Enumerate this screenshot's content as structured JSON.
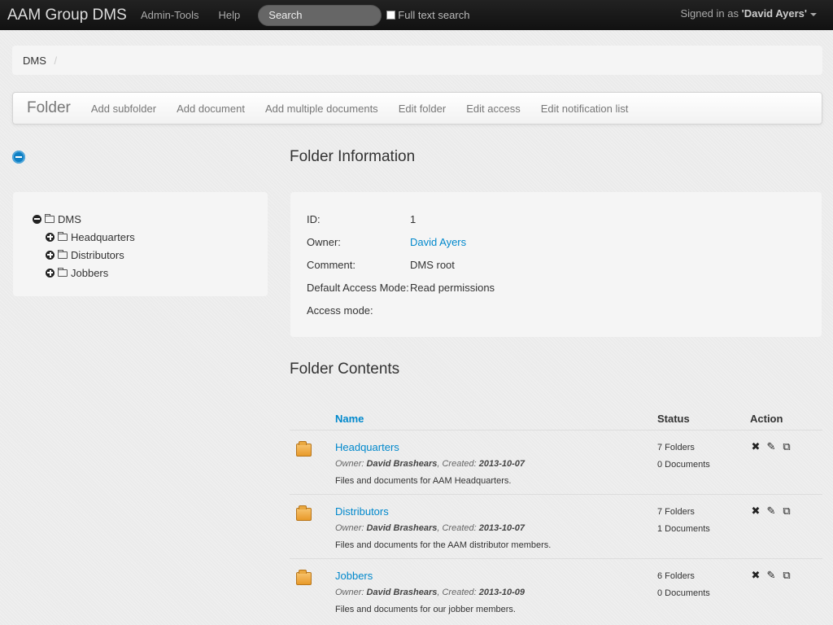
{
  "navbar": {
    "brand": "AAM Group DMS",
    "items": [
      "Admin-Tools",
      "Help"
    ],
    "search_placeholder": "Search",
    "full_text_label": "Full text search",
    "signed_in_prefix": "Signed in as",
    "user": "'David Ayers'"
  },
  "breadcrumb": {
    "root": "DMS",
    "separator": "/"
  },
  "subnav": {
    "title": "Folder",
    "items": [
      "Add subfolder",
      "Add document",
      "Add multiple documents",
      "Edit folder",
      "Edit access",
      "Edit notification list"
    ]
  },
  "tree": {
    "root": "DMS",
    "children": [
      "Headquarters",
      "Distributors",
      "Jobbers"
    ]
  },
  "info": {
    "heading": "Folder Information",
    "rows": [
      {
        "label": "ID:",
        "value": "1"
      },
      {
        "label": "Owner:",
        "value": "David Ayers"
      },
      {
        "label": "Comment:",
        "value": "DMS root"
      },
      {
        "label": "Default Access Mode:",
        "value": "Read permissions"
      },
      {
        "label": "Access mode:",
        "value": ""
      }
    ]
  },
  "contents": {
    "heading": "Folder Contents",
    "columns": {
      "name": "Name",
      "status": "Status",
      "action": "Action"
    },
    "rows": [
      {
        "name": "Headquarters",
        "owner_prefix": "Owner:",
        "owner": "David Brashears",
        "created_prefix": ", Created:",
        "created": "2013-10-07",
        "description": "Files and documents for AAM Headquarters.",
        "folders": "7 Folders",
        "documents": "0 Documents"
      },
      {
        "name": "Distributors",
        "owner_prefix": "Owner:",
        "owner": "David Brashears",
        "created_prefix": ", Created:",
        "created": "2013-10-07",
        "description": "Files and documents for the AAM distributor members.",
        "folders": "7 Folders",
        "documents": "1 Documents"
      },
      {
        "name": "Jobbers",
        "owner_prefix": "Owner:",
        "owner": "David Brashears",
        "created_prefix": ", Created:",
        "created": "2013-10-09",
        "description": "Files and documents for our jobber members.",
        "folders": "6 Folders",
        "documents": "0 Documents"
      }
    ],
    "action_icons": {
      "delete": "✖",
      "edit": "✎",
      "copy": "⧉"
    }
  }
}
